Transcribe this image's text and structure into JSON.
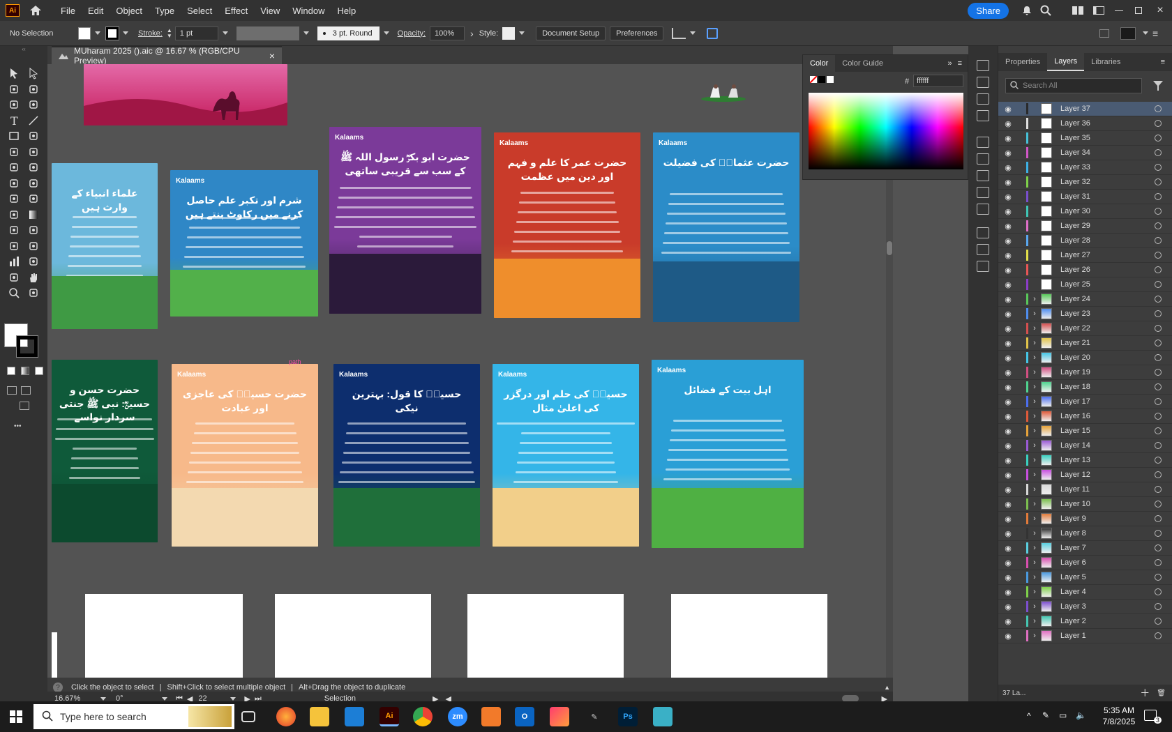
{
  "menubar": {
    "app_icon": "Ai",
    "items": [
      "File",
      "Edit",
      "Object",
      "Type",
      "Select",
      "Effect",
      "View",
      "Window",
      "Help"
    ],
    "share_label": "Share"
  },
  "control_bar": {
    "selection": "No Selection",
    "stroke_label": "Stroke:",
    "stroke_value": "1 pt",
    "brush_label": "3 pt. Round",
    "opacity_label": "Opacity:",
    "opacity_value": "100%",
    "style_label": "Style:",
    "document_setup": "Document Setup",
    "preferences": "Preferences"
  },
  "document_tab": {
    "title": "MUharam 2025 ().aic @ 16.67 % (RGB/CPU Preview)",
    "close": "×"
  },
  "canvas": {
    "cursor_label": "path",
    "artboards": [
      {
        "title": "علماء انبیاء کے وارث ہیں",
        "bg": "#6cb8dc",
        "ground": "#3f9a44"
      },
      {
        "title": "شرم اور تکبر علم حاصل کرنے میں رکاوٹ بنتے ہیں",
        "bg": "#2f87c6",
        "ground": "#52b04a",
        "logo": "Kalaams"
      },
      {
        "title": "حضرت ابو بکرؓ رسول اللہ ﷺ کے سب سے قریبی ساتھی",
        "bg": "#7b3a99",
        "ground": "#2b1a3a",
        "logo": "Kalaams"
      },
      {
        "title": "حضرت عمر کا علم و فہم اور دین میں عظمت",
        "bg": "#c93b2a",
        "ground": "#ef8e2c",
        "logo": "Kalaams"
      },
      {
        "title": "حضرت عثمانؓ کی فضیلت",
        "bg": "#2b8cc8",
        "ground": "#1e5a86",
        "logo": "Kalaams"
      },
      {
        "title": "حضرت حسن و حسینؓ: نبی ﷺ جنتی سردار نواسے",
        "bg": "#0f5a3a",
        "ground": "#0c4a2e"
      },
      {
        "title": "حضرت حسینؓ کی عاجزی اور عبادت",
        "bg": "#f7b98a",
        "ground": "#f3d9b0",
        "logo": "Kalaams"
      },
      {
        "title": "حسینؓ کا قول: بہترین نیکی",
        "bg": "#0d2e6e",
        "ground": "#1f6f3a",
        "logo": "Kalaams"
      },
      {
        "title": "حسینؓ کی حلم اور درگزر کی اعلیٰ مثال",
        "bg": "#34b5e8",
        "ground": "#f2cf8a",
        "logo": "Kalaams"
      },
      {
        "title": "اہل بیت کے فضائل",
        "bg": "#2a9fd6",
        "ground": "#4fb043",
        "logo": "Kalaams"
      }
    ]
  },
  "status": {
    "hint1": "Click the object to select",
    "hint2": "Shift+Click to select multiple object",
    "hint3": "Alt+Drag the object to duplicate",
    "zoom": "16.67%",
    "angle": "0°",
    "artboard_num": "22",
    "mode": "Selection"
  },
  "color_panel": {
    "tab_color": "Color",
    "tab_guide": "Color Guide",
    "hex_label": "#",
    "hex_value": "ffffff"
  },
  "right_panel": {
    "tabs": [
      "Properties",
      "Layers",
      "Libraries"
    ],
    "search_placeholder": "Search All",
    "layer_count": "37 La...",
    "layers": [
      {
        "name": "Layer 37",
        "color": "#2a2a2a",
        "sub": false
      },
      {
        "name": "Layer 36",
        "color": "#e0e0e0",
        "sub": false
      },
      {
        "name": "Layer 35",
        "color": "#46c2d8",
        "sub": false
      },
      {
        "name": "Layer 34",
        "color": "#d257c8",
        "sub": false
      },
      {
        "name": "Layer 33",
        "color": "#3db2e6",
        "sub": false
      },
      {
        "name": "Layer 32",
        "color": "#7fd24a",
        "sub": false
      },
      {
        "name": "Layer 31",
        "color": "#7a4fcf",
        "sub": false
      },
      {
        "name": "Layer 30",
        "color": "#3fc7b7",
        "sub": false
      },
      {
        "name": "Layer 29",
        "color": "#e06fc9",
        "sub": false
      },
      {
        "name": "Layer 28",
        "color": "#5aa8f0",
        "sub": false
      },
      {
        "name": "Layer 27",
        "color": "#e3e04a",
        "sub": false
      },
      {
        "name": "Layer 26",
        "color": "#e85656",
        "sub": false
      },
      {
        "name": "Layer 25",
        "color": "#8d3dc9",
        "sub": false
      },
      {
        "name": "Layer 24",
        "color": "#59c95a",
        "sub": true
      },
      {
        "name": "Layer 23",
        "color": "#4f8ef0",
        "sub": true
      },
      {
        "name": "Layer 22",
        "color": "#d64f4f",
        "sub": true
      },
      {
        "name": "Layer 21",
        "color": "#e2c44a",
        "sub": true
      },
      {
        "name": "Layer 20",
        "color": "#45c7e8",
        "sub": true
      },
      {
        "name": "Layer 19",
        "color": "#d24f82",
        "sub": true
      },
      {
        "name": "Layer 18",
        "color": "#4fd48f",
        "sub": true
      },
      {
        "name": "Layer 17",
        "color": "#4c6ff0",
        "sub": true
      },
      {
        "name": "Layer 16",
        "color": "#e05a3a",
        "sub": true
      },
      {
        "name": "Layer 15",
        "color": "#e7a33a",
        "sub": true
      },
      {
        "name": "Layer 14",
        "color": "#9b5ad6",
        "sub": true
      },
      {
        "name": "Layer 13",
        "color": "#3ad1c0",
        "sub": true
      },
      {
        "name": "Layer 12",
        "color": "#c94fe0",
        "sub": true
      },
      {
        "name": "Layer 11",
        "color": "#d9d9d9",
        "sub": true
      },
      {
        "name": "Layer 10",
        "color": "#7cc04f",
        "sub": true
      },
      {
        "name": "Layer 9",
        "color": "#e37b3a",
        "sub": true
      },
      {
        "name": "Layer 8",
        "color": "#333333",
        "sub": true
      },
      {
        "name": "Layer 7",
        "color": "#5ad0e0",
        "sub": true
      },
      {
        "name": "Layer 6",
        "color": "#d94fb0",
        "sub": true
      },
      {
        "name": "Layer 5",
        "color": "#4a9ae0",
        "sub": true
      },
      {
        "name": "Layer 4",
        "color": "#7fd14a",
        "sub": true
      },
      {
        "name": "Layer 3",
        "color": "#7d4fd0",
        "sub": true
      },
      {
        "name": "Layer 2",
        "color": "#45c7b3",
        "sub": true
      },
      {
        "name": "Layer 1",
        "color": "#e06fc2",
        "sub": true
      }
    ]
  },
  "taskbar": {
    "search_placeholder": "Type here to search",
    "time": "5:35 AM",
    "date": "7/8/2025",
    "notif_count": "3"
  },
  "colors": {
    "accent": "#1473e6",
    "chrome_dark": "#323232",
    "chrome_mid": "#3d3d3d",
    "canvas": "#535353"
  }
}
